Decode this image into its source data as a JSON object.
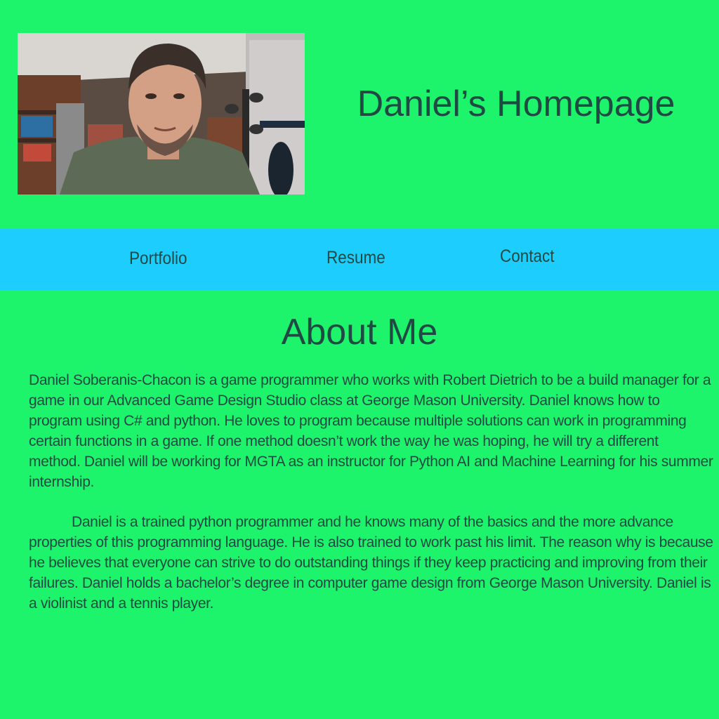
{
  "header": {
    "title": "Daniel’s Homepage",
    "photo_alt": "Photo of Daniel"
  },
  "nav": {
    "items": [
      {
        "label": "Portfolio"
      },
      {
        "label": "Resume"
      },
      {
        "label": "Contact"
      }
    ]
  },
  "about": {
    "heading": "About Me",
    "paragraphs": [
      "Daniel Soberanis-Chacon is a game programmer who works with Robert Dietrich to be a build manager for a game in our Advanced Game Design Studio class at George Mason University. Daniel knows how to program using C# and python. He loves to program because multiple solutions can work in programming certain functions in a game. If one method doesn’t work the way he was hoping, he will try a different method. Daniel will be working for MGTA as an instructor for Python AI and Machine Learning for his summer internship.",
      "Daniel is a trained python programmer and he knows many of the basics and the more advance properties of this programming language. He is also trained to work past his limit. The reason why is because he believes that everyone can strive to do outstanding things if they keep practicing and improving from their failures. Daniel holds a bachelor’s degree in computer game design from George Mason University. Daniel is a violinist and a tennis player."
    ]
  },
  "colors": {
    "background": "#1ef46b",
    "navbar": "#1ccdfd",
    "text": "#1f4a44"
  }
}
